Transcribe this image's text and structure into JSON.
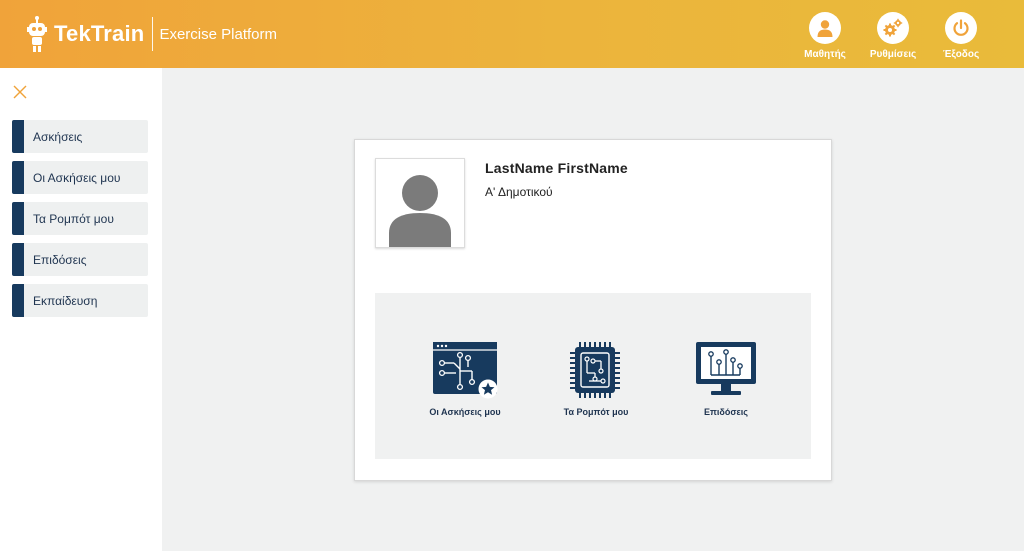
{
  "header": {
    "brand_name": "TekTrain",
    "tagline": "Exercise Platform",
    "actions": [
      {
        "label": "Μαθητής",
        "icon": "user-icon"
      },
      {
        "label": "Ρυθμίσεις",
        "icon": "gears-icon"
      },
      {
        "label": "Έξοδος",
        "icon": "power-icon"
      }
    ]
  },
  "sidebar": {
    "items": [
      {
        "label": "Ασκήσεις"
      },
      {
        "label": "Οι Ασκήσεις μου"
      },
      {
        "label": "Τα Ρομπότ μου"
      },
      {
        "label": "Επιδόσεις"
      },
      {
        "label": "Εκπαίδευση"
      }
    ]
  },
  "profile": {
    "name": "LastName FirstName",
    "class": "Α' Δημοτικού"
  },
  "tiles": [
    {
      "label": "Οι Ασκήσεις μου",
      "icon": "exercise-window-icon"
    },
    {
      "label": "Τα Ρομπότ μου",
      "icon": "chip-icon"
    },
    {
      "label": "Επιδόσεις",
      "icon": "monitor-circuit-icon"
    }
  ],
  "colors": {
    "header_start": "#f0a33a",
    "header_end": "#e9bb3a",
    "navy": "#173a5e",
    "background": "#f0f1f1"
  }
}
